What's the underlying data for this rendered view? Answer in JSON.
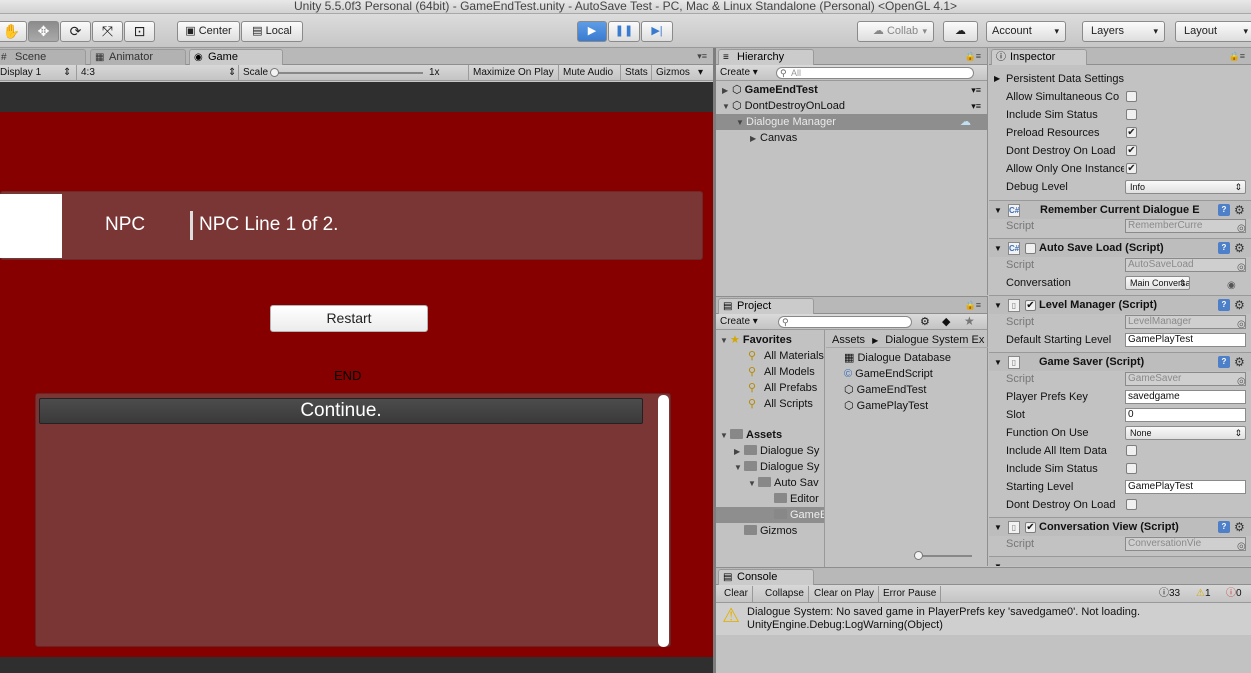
{
  "window": {
    "title": "Unity 5.5.0f3 Personal (64bit) - GameEndTest.unity - AutoSave Test - PC, Mac & Linux Standalone (Personal) <OpenGL 4.1>"
  },
  "toolbar": {
    "tools": [
      "hand-icon",
      "move-icon",
      "rotate-icon",
      "scale-icon",
      "rect-icon"
    ],
    "pivot": "Center",
    "space": "Local",
    "collab": "Collab",
    "account": "Account",
    "layers": "Layers",
    "layout": "Layout"
  },
  "game_panel": {
    "tabs": [
      {
        "label": "Scene",
        "icon": "scene-icon"
      },
      {
        "label": "Animator",
        "icon": "animator-icon"
      },
      {
        "label": "Game",
        "icon": "game-icon"
      }
    ],
    "display": "Display 1",
    "aspect": "4:3",
    "scale_label": "Scale",
    "scale_value": "1x",
    "maximize": "Maximize On Play",
    "mute": "Mute Audio",
    "stats": "Stats",
    "gizmos": "Gizmos"
  },
  "game_view": {
    "npc_name": "NPC",
    "npc_line": "NPC Line 1 of 2.",
    "restart": "Restart",
    "end_text": "END",
    "continue": "Continue.",
    "background_color": "#860000",
    "panel_color": "#7a3535"
  },
  "hierarchy": {
    "tab": "Hierarchy",
    "create": "Create",
    "search_placeholder": "All",
    "items": [
      {
        "label": "GameEndTest",
        "bold": true
      },
      {
        "label": "DontDestroyOnLoad",
        "bold": false
      },
      {
        "label": "Dialogue Manager"
      },
      {
        "label": "Canvas"
      }
    ]
  },
  "project": {
    "tab": "Project",
    "create": "Create",
    "favorites_label": "Favorites",
    "favorites": [
      "All Materials",
      "All Models",
      "All Prefabs",
      "All Scripts"
    ],
    "assets_label": "Assets",
    "folders": [
      "Dialogue Sy",
      "Dialogue Sy",
      "Auto Sav",
      "Editor",
      "GameE",
      "Gizmos"
    ],
    "breadcrumb_root": "Assets",
    "breadcrumb_current": "Dialogue System Ex",
    "files": [
      "Dialogue Database",
      "GameEndScript",
      "GameEndTest",
      "GamePlayTest"
    ]
  },
  "inspector": {
    "tab": "Inspector",
    "top_rows": [
      {
        "label": "Persistent Data Settings"
      },
      {
        "label": "Allow Simultaneous Co",
        "checked": false
      },
      {
        "label": "Include Sim Status",
        "checked": false
      },
      {
        "label": "Preload Resources",
        "checked": true
      },
      {
        "label": "Dont Destroy On Load",
        "checked": true
      },
      {
        "label": "Allow Only One Instance",
        "checked": true
      },
      {
        "label": "Debug Level",
        "value": "Info"
      }
    ],
    "remember": {
      "name": "Remember Current Dialogue En",
      "script_label": "Script",
      "script": "RememberCurre"
    },
    "autosave": {
      "name": "Auto Save Load (Script)",
      "script_label": "Script",
      "script": "AutoSaveLoad",
      "conversation_label": "Conversation",
      "conversation": "Main Conversatic"
    },
    "level_manager": {
      "name": "Level Manager (Script)",
      "script_label": "Script",
      "script": "LevelManager",
      "default_label": "Default Starting Level",
      "default": "GamePlayTest"
    },
    "game_saver": {
      "name": "Game Saver (Script)",
      "script_label": "Script",
      "script": "GameSaver",
      "key_label": "Player Prefs Key",
      "key": "savedgame",
      "slot_label": "Slot",
      "slot": "0",
      "function_label": "Function On Use",
      "function": "None",
      "include_data_label": "Include All Item Data",
      "include_sim_label": "Include Sim Status",
      "starting_label": "Starting Level",
      "starting": "GamePlayTest",
      "dont_destroy_label": "Dont Destroy On Load"
    },
    "conversation_view": {
      "name": "Conversation View (Script)",
      "script_label": "Script",
      "script": "ConversationVie"
    }
  },
  "console": {
    "tab": "Console",
    "buttons": [
      "Clear",
      "Collapse",
      "Clear on Play",
      "Error Pause"
    ],
    "info_count": "33",
    "warn_count": "1",
    "error_count": "0",
    "message_line1": "Dialogue System: No saved game in PlayerPrefs key 'savedgame0'. Not loading.",
    "message_line2": "UnityEngine.Debug:LogWarning(Object)"
  }
}
